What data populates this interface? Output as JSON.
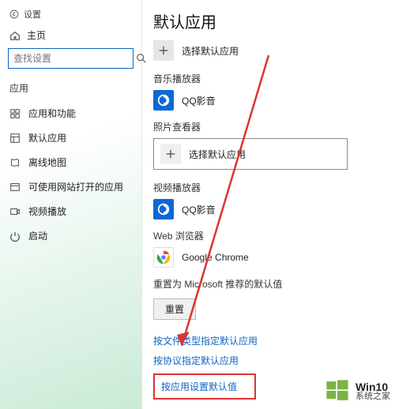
{
  "window": {
    "title": "设置"
  },
  "sidebar": {
    "home_label": "主页",
    "search_placeholder": "查找设置",
    "section_label": "应用",
    "items": [
      {
        "label": "应用和功能"
      },
      {
        "label": "默认应用"
      },
      {
        "label": "离线地图"
      },
      {
        "label": "可使用网站打开的应用"
      },
      {
        "label": "视频播放"
      },
      {
        "label": "启动"
      }
    ]
  },
  "main": {
    "page_title": "默认应用",
    "choose_default_label": "选择默认应用",
    "sections": {
      "music": {
        "heading": "音乐播放器",
        "app": "QQ影音"
      },
      "photo": {
        "heading": "照片查看器",
        "choose_label": "选择默认应用"
      },
      "video": {
        "heading": "视频播放器",
        "app": "QQ影音"
      },
      "web": {
        "heading": "Web 浏览器",
        "app": "Google Chrome"
      }
    },
    "reset_label": "重置为 Microsoft 推荐的默认值",
    "reset_button": "重置",
    "links": [
      "按文件类型指定默认应用",
      "按协议指定默认应用",
      "按应用设置默认值"
    ]
  },
  "watermark": {
    "line1": "Win10",
    "line2": "系统之家"
  }
}
